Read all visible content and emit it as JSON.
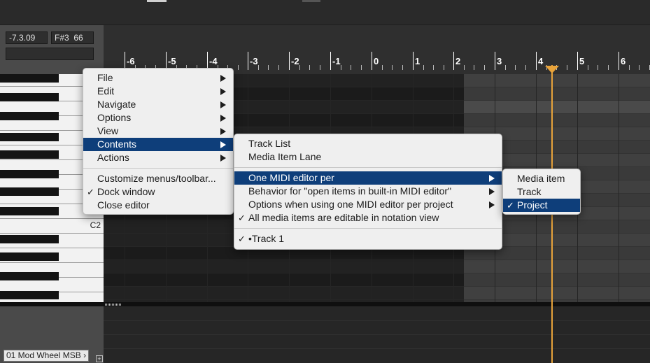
{
  "readouts": {
    "position": "-7.3.09",
    "pitch": "F#3  66"
  },
  "ruler": {
    "labels": [
      "-6",
      "-5",
      "-4",
      "-3",
      "-2",
      "-1",
      "0",
      "1",
      "2",
      "3",
      "4",
      "5",
      "6"
    ]
  },
  "piano": {
    "c_label": "C2"
  },
  "cc_lane": {
    "selector_label": "01 Mod Wheel MSB",
    "add_label": "+"
  },
  "colors": {
    "menu_highlight": "#0e3e7a",
    "playhead": "#e8a33a"
  },
  "menus": {
    "main": {
      "items": [
        {
          "label": "File"
        },
        {
          "label": "Edit"
        },
        {
          "label": "Navigate"
        },
        {
          "label": "Options"
        },
        {
          "label": "View"
        },
        {
          "label": "Contents"
        },
        {
          "label": "Actions"
        },
        {
          "label": "Customize menus/toolbar..."
        },
        {
          "label": "Dock window"
        },
        {
          "label": "Close editor"
        }
      ]
    },
    "contents": {
      "items": [
        {
          "label": "Track List"
        },
        {
          "label": "Media Item Lane"
        },
        {
          "label": "One MIDI editor per"
        },
        {
          "label": "Behavior for \"open items in built-in MIDI editor\""
        },
        {
          "label": "Options when using one MIDI editor per project"
        },
        {
          "label": "All media items are editable in notation view"
        },
        {
          "label": "•Track 1"
        }
      ]
    },
    "editor_per": {
      "items": [
        {
          "label": "Media item"
        },
        {
          "label": "Track"
        },
        {
          "label": "Project"
        }
      ]
    },
    "check_glyph": "✓"
  }
}
